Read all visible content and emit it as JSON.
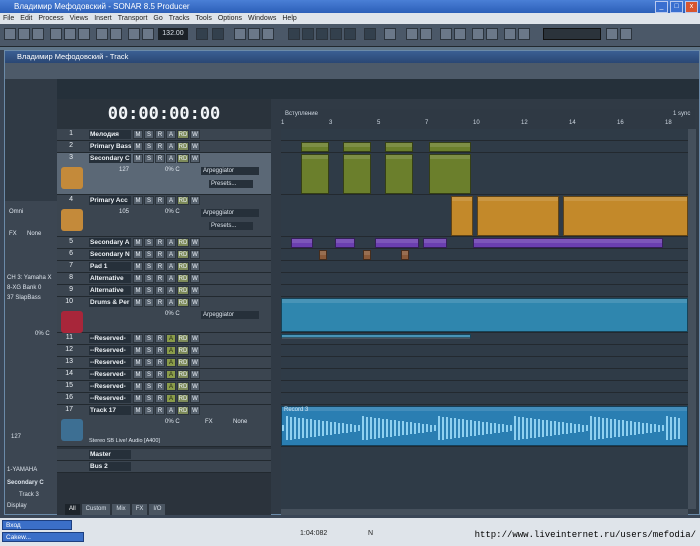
{
  "app": {
    "title": "Владимир Мефодовский - SONAR 8.5 Producer",
    "menu": [
      "File",
      "Edit",
      "Process",
      "Views",
      "Insert",
      "Transport",
      "Go",
      "Tracks",
      "Tools",
      "Options",
      "Windows",
      "Help"
    ],
    "tempo": "132.00"
  },
  "track_window": {
    "title": "Владимир Мефодовский - Track",
    "time_display": "00:00:00:00",
    "marker_start": "Вступление",
    "ruler_mark": "1 sync"
  },
  "tracks": [
    {
      "num": "1",
      "name": "Мелодия"
    },
    {
      "num": "2",
      "name": "Primary Bass"
    },
    {
      "num": "3",
      "name": "Secondary C",
      "selected": true,
      "arp": "Arpeggiator",
      "preset": "Presets...",
      "vol": "127",
      "pan": "0% C"
    },
    {
      "num": "4",
      "name": "Primary Acc",
      "arp": "Arpeggiator",
      "preset": "Presets...",
      "vol": "105",
      "pan": "0% C"
    },
    {
      "num": "5",
      "name": "Secondary A"
    },
    {
      "num": "6",
      "name": "Secondary N"
    },
    {
      "num": "7",
      "name": "Pad 1"
    },
    {
      "num": "8",
      "name": "Alternative"
    },
    {
      "num": "9",
      "name": "Alternative"
    },
    {
      "num": "10",
      "name": "Drums & Per",
      "arp": "Arpeggiator",
      "pan": "0% C"
    },
    {
      "num": "11",
      "name": "--Reserved-"
    },
    {
      "num": "12",
      "name": "--Reserved-"
    },
    {
      "num": "13",
      "name": "--Reserved-"
    },
    {
      "num": "14",
      "name": "--Reserved-"
    },
    {
      "num": "15",
      "name": "--Reserved-"
    },
    {
      "num": "16",
      "name": "--Reserved-"
    },
    {
      "num": "17",
      "name": "Track 17",
      "fx": "FX",
      "none": "None",
      "input": "Stereo SB Live! Audio [A400]",
      "pan": "0% C"
    }
  ],
  "buses": [
    {
      "name": "Master"
    },
    {
      "name": "Bus 2"
    }
  ],
  "track_buttons": [
    "M",
    "S",
    "R",
    "A",
    "RD",
    "W"
  ],
  "inspector": {
    "input": "Omni",
    "fx": "FX",
    "none": "None",
    "ch_lines": [
      "CH 3: Yamaha X",
      "8-XG Bank 0",
      "37 SlapBass"
    ],
    "pan": "0% C",
    "vol": "127",
    "output": "1-YAMAHA",
    "track_name": "Secondary C",
    "track_num": "Track 3",
    "display_label": "Display"
  },
  "bottom_tabs": [
    "All",
    "Custom",
    "Mix",
    "FX",
    "I/O"
  ],
  "clip_label": "Record 3",
  "status": {
    "taskbar": [
      "Вход",
      "Cakew..."
    ],
    "time": "1:04:082",
    "mode": "N",
    "url": "http://www.liveinternet.ru/users/mefodia/"
  },
  "colors": {
    "green_clip": "#6b7f2c",
    "orange_clip": "#c3892a",
    "purple_clip": "#6b3fb0",
    "teal_clip": "#2f86ae",
    "audio_wave": "#2a7eb2"
  }
}
